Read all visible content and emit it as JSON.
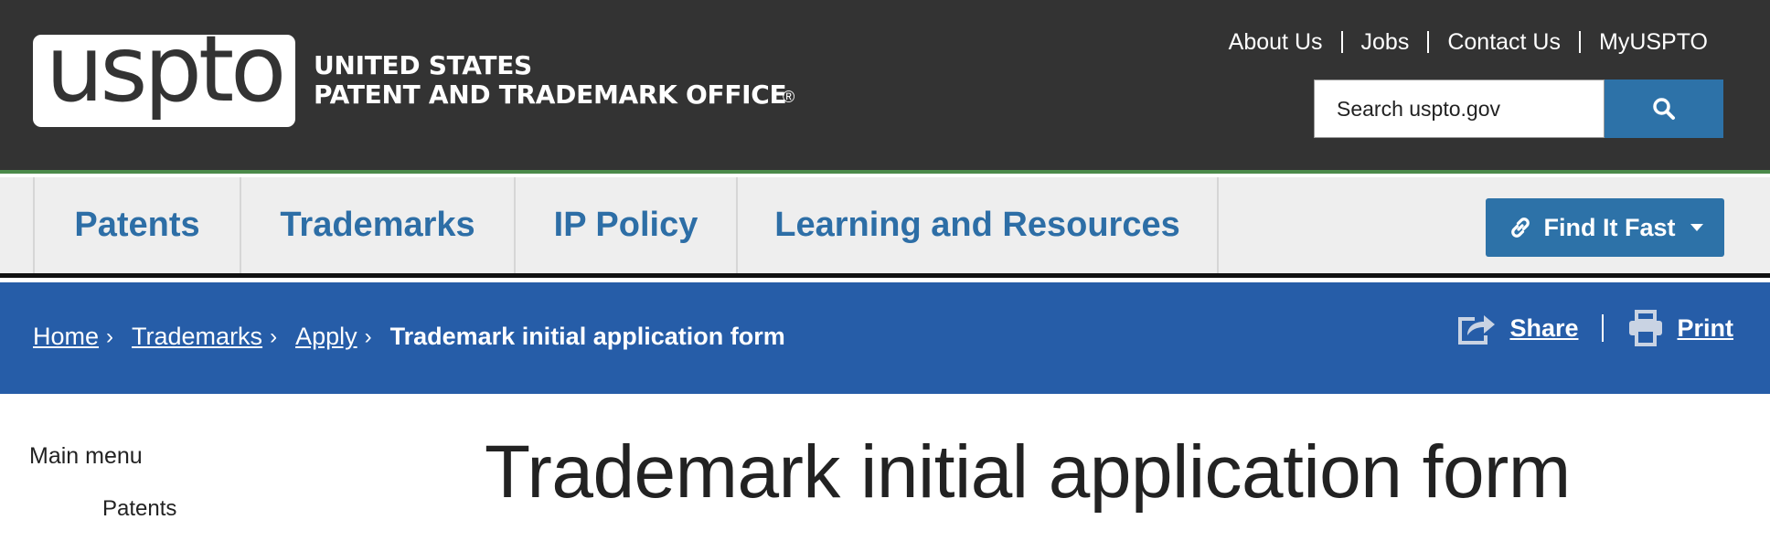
{
  "header": {
    "logo_text": "uspto",
    "agency_line1": "UNITED STATES",
    "agency_line2": "PATENT AND TRADEMARK OFFICE",
    "registered_mark": "®",
    "utility_links": [
      "About Us",
      "Jobs",
      "Contact Us",
      "MyUSPTO"
    ],
    "search": {
      "placeholder": "Search uspto.gov",
      "button_icon": "search-icon"
    }
  },
  "main_nav": {
    "items": [
      "Patents",
      "Trademarks",
      "IP Policy",
      "Learning and Resources"
    ],
    "find_it_fast": "Find It Fast"
  },
  "breadcrumb": {
    "items": [
      "Home",
      "Trademarks",
      "Apply"
    ],
    "current": "Trademark initial application form",
    "separator": "›"
  },
  "actions": {
    "share": "Share",
    "print": "Print"
  },
  "sidebar": {
    "title": "Main menu",
    "items": [
      "Patents"
    ]
  },
  "page": {
    "title": "Trademark initial application form"
  },
  "colors": {
    "header_bg": "#333333",
    "header_accent": "#4b8a4a",
    "nav_bg": "#eeeeee",
    "nav_link": "#2d6ea6",
    "button_blue": "#2d72a8",
    "crumb_bg": "#265da8"
  }
}
